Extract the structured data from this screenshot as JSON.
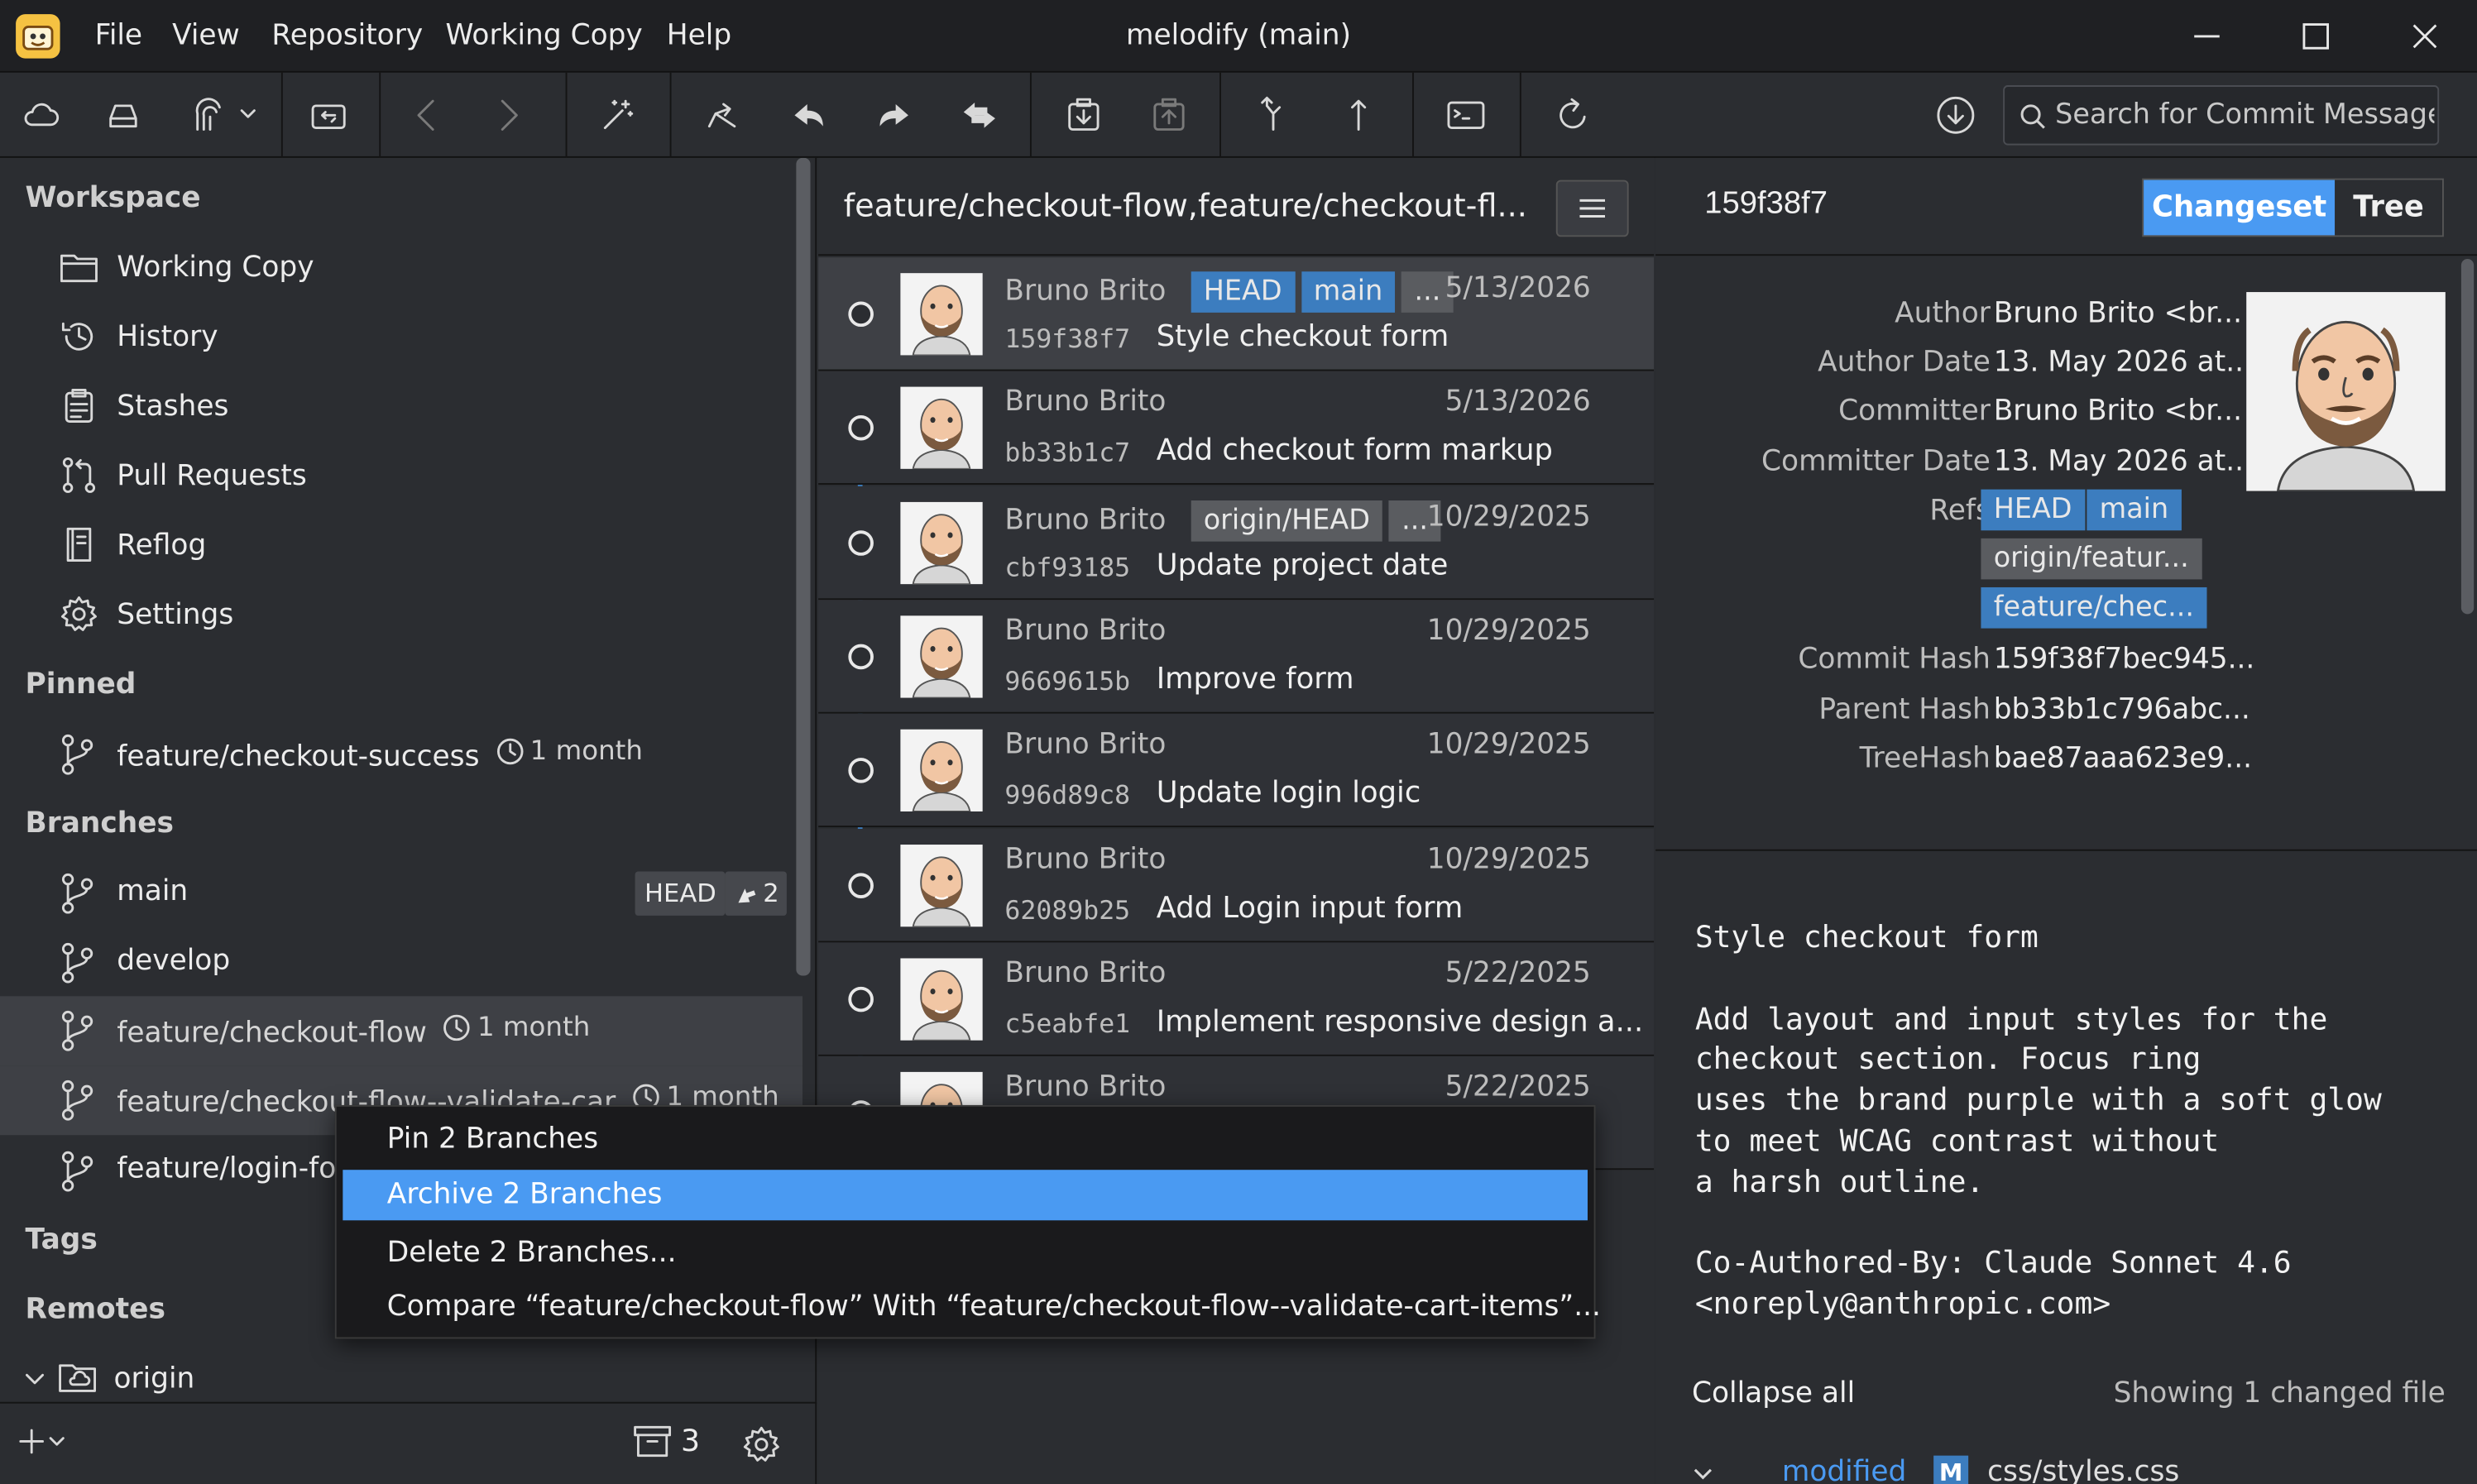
{
  "menubar": {
    "items": [
      "File",
      "View",
      "Repository",
      "Working Copy",
      "Help"
    ],
    "title": "melodify (main)"
  },
  "search": {
    "placeholder": "Search for Commit Message"
  },
  "sidebar": {
    "workspace_heading": "Workspace",
    "workspace_items": [
      "Working Copy",
      "History",
      "Stashes",
      "Pull Requests",
      "Reflog",
      "Settings"
    ],
    "pinned_heading": "Pinned",
    "pinned": [
      {
        "name": "feature/checkout-success",
        "age": "1 month"
      }
    ],
    "branches_heading": "Branches",
    "branches": [
      {
        "name": "main",
        "badge": "HEAD",
        "ahead": "2"
      },
      {
        "name": "develop"
      },
      {
        "name": "feature/checkout-flow",
        "age": "1 month"
      },
      {
        "name": "feature/checkout-flow--validate-car",
        "age": "1 month"
      },
      {
        "name": "feature/login-for"
      }
    ],
    "tags_heading": "Tags",
    "remotes_heading": "Remotes",
    "remotes": [
      "origin"
    ],
    "footer": {
      "archive_count": "3"
    }
  },
  "commits": {
    "header": "feature/checkout-flow,feature/checkout-fl...",
    "rows": [
      {
        "author": "Bruno Brito",
        "refs": [
          "HEAD",
          "main",
          "..."
        ],
        "date": "5/13/2026",
        "hash": "159f38f7",
        "message": "Style checkout form"
      },
      {
        "author": "Bruno Brito",
        "refs": [],
        "date": "5/13/2026",
        "hash": "bb33b1c7",
        "message": "Add checkout form markup"
      },
      {
        "author": "Bruno Brito",
        "refs": [
          "origin/HEAD",
          "..."
        ],
        "date": "10/29/2025",
        "hash": "cbf93185",
        "message": "Update project date"
      },
      {
        "author": "Bruno Brito",
        "refs": [],
        "date": "10/29/2025",
        "hash": "9669615b",
        "message": "Improve form"
      },
      {
        "author": "Bruno Brito",
        "refs": [],
        "date": "10/29/2025",
        "hash": "996d89c8",
        "message": "Update login logic"
      },
      {
        "author": "Bruno Brito",
        "refs": [],
        "date": "10/29/2025",
        "hash": "62089b25",
        "message": "Add Login input form"
      },
      {
        "author": "Bruno Brito",
        "refs": [],
        "date": "5/22/2025",
        "hash": "c5eabfe1",
        "message": "Implement responsive design a..."
      },
      {
        "author": "Bruno Brito",
        "refs": [],
        "date": "5/22/2025",
        "hash": "",
        "message": ""
      }
    ]
  },
  "context_menu": {
    "items": [
      "Pin 2 Branches",
      "Archive 2 Branches",
      "Delete 2 Branches...",
      "Compare “feature/checkout-flow” With “feature/checkout-flow--validate-cart-items”..."
    ],
    "highlighted": "Archive 2 Branches"
  },
  "detail": {
    "commit_id": "159f38f7",
    "tabs": [
      "Changeset",
      "Tree"
    ],
    "active_tab": "Changeset",
    "meta": [
      {
        "key": "Author",
        "value": "Bruno Brito <br..."
      },
      {
        "key": "Author Date",
        "value": "13. May 2026 at..."
      },
      {
        "key": "Committer",
        "value": "Bruno Brito <br..."
      },
      {
        "key": "Committer Date",
        "value": "13. May 2026 at..."
      },
      {
        "key": "Refs",
        "value": ""
      },
      {
        "key": "Commit Hash",
        "value": "159f38f7bec945..."
      },
      {
        "key": "Parent Hash",
        "value": "bb33b1c796abc..."
      },
      {
        "key": "TreeHash",
        "value": "bae87aaa623e9..."
      }
    ],
    "refs": [
      "HEAD",
      "main",
      "origin/featur...",
      "feature/chec..."
    ],
    "message": "Style checkout form\n\nAdd layout and input styles for the\ncheckout section. Focus ring\nuses the brand purple with a soft glow\nto meet WCAG contrast without\na harsh outline.\n\nCo-Authored-By: Claude Sonnet 4.6\n<noreply@anthropic.com>",
    "collapse_all": "Collapse all",
    "showing": "Showing 1 changed file",
    "file": {
      "status": "modified",
      "badge": "M",
      "path": "css/styles.css"
    }
  },
  "colors": {
    "accent": "#4a9af2",
    "ref_blue": "#3c7dbf",
    "ref_gray": "#5a5c60"
  }
}
